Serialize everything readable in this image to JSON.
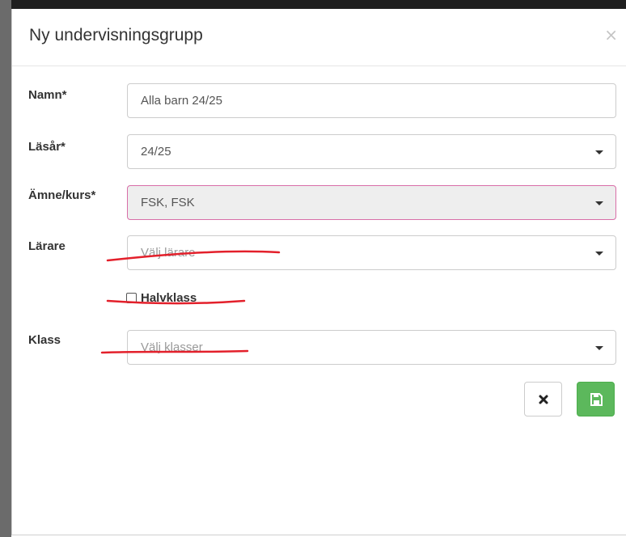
{
  "modal": {
    "title": "Ny undervisningsgrupp",
    "close": "×"
  },
  "form": {
    "namn": {
      "label": "Namn*",
      "value": "Alla barn 24/25"
    },
    "lasar": {
      "label": "Läsår*",
      "value": "24/25"
    },
    "amne": {
      "label": "Ämne/kurs*",
      "value": "FSK, FSK"
    },
    "larare": {
      "label": "Lärare",
      "placeholder": "Välj lärare"
    },
    "halvklass": {
      "label": "Halvklass",
      "checked": false
    },
    "klass": {
      "label": "Klass",
      "placeholder": "Välj klasser"
    }
  },
  "buttons": {
    "cancel": "cancel",
    "save": "save"
  },
  "colors": {
    "annotation": "#e3202b",
    "save_green": "#5cb85c",
    "invalid_border": "#d86ea8"
  }
}
